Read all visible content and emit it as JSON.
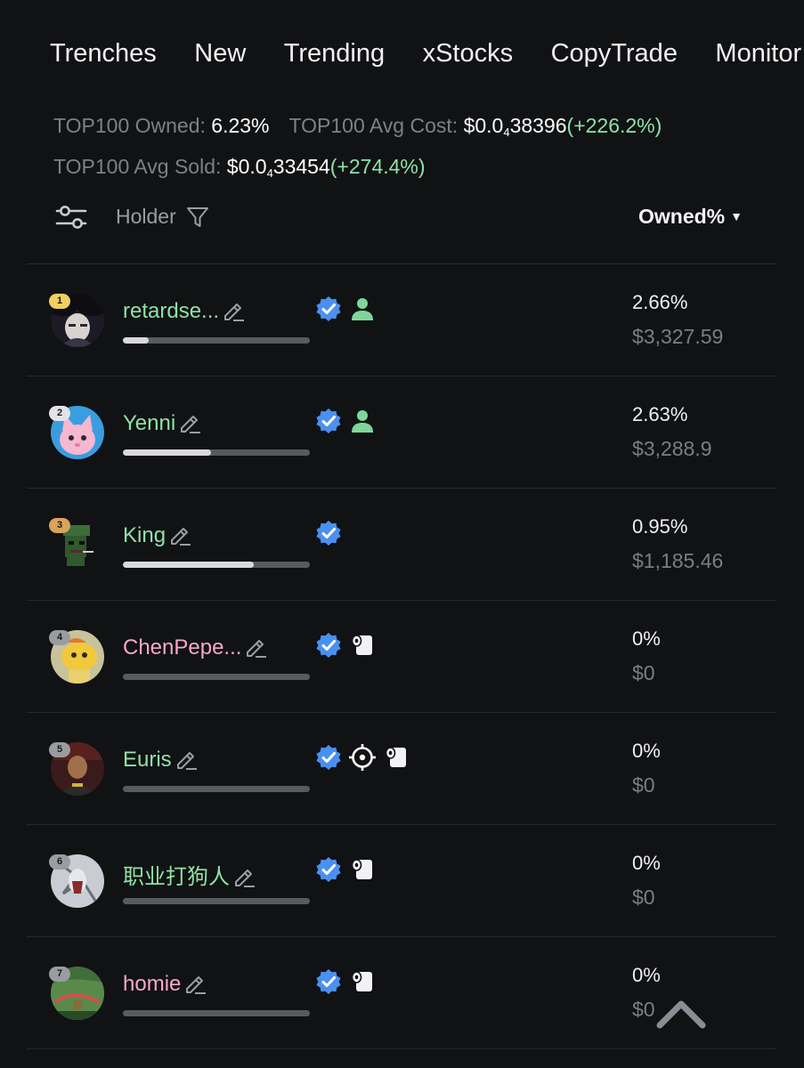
{
  "nav": {
    "tabs": [
      "Trenches",
      "New",
      "Trending",
      "xStocks",
      "CopyTrade",
      "Monitor"
    ]
  },
  "stats": {
    "owned_label": "TOP100 Owned:",
    "owned_value": "6.23%",
    "avg_cost_label": "TOP100 Avg Cost:",
    "avg_cost_prefix": "$0.0",
    "avg_cost_sub": "4",
    "avg_cost_digits": "38396",
    "avg_cost_change": "(+226.2%)",
    "avg_sold_label": "TOP100 Avg Sold:",
    "avg_sold_prefix": "$0.0",
    "avg_sold_sub": "4",
    "avg_sold_digits": "33454",
    "avg_sold_change": "(+274.4%)"
  },
  "table": {
    "holder_label": "Holder",
    "sort_label": "Owned%"
  },
  "colors": {
    "name_green": "#8fe2a6",
    "name_pink": "#f7a8c8",
    "verified_blue": "#4a90f0"
  },
  "holders": [
    {
      "rank": "1",
      "name": "retardse...",
      "name_color": "green",
      "bar": 0.14,
      "icons": [
        "verified-icon",
        "user-icon"
      ],
      "owned": "2.66%",
      "usd": "$3,327.59"
    },
    {
      "rank": "2",
      "name": "Yenni",
      "name_color": "green",
      "bar": 0.47,
      "icons": [
        "verified-icon",
        "user-icon"
      ],
      "owned": "2.63%",
      "usd": "$3,288.9"
    },
    {
      "rank": "3",
      "name": "King",
      "name_color": "green",
      "bar": 0.7,
      "icons": [
        "verified-icon"
      ],
      "owned": "0.95%",
      "usd": "$1,185.46"
    },
    {
      "rank": "4",
      "name": "ChenPepe...",
      "name_color": "pink",
      "bar": 0,
      "icons": [
        "verified-icon",
        "paper-roll-icon"
      ],
      "owned": "0%",
      "usd": "$0"
    },
    {
      "rank": "5",
      "name": "Euris",
      "name_color": "green",
      "bar": 0,
      "icons": [
        "verified-icon",
        "crosshair-icon",
        "paper-roll-icon"
      ],
      "owned": "0%",
      "usd": "$0"
    },
    {
      "rank": "6",
      "name": "职业打狗人",
      "name_color": "green",
      "bar": 0,
      "icons": [
        "verified-icon",
        "paper-roll-icon"
      ],
      "owned": "0%",
      "usd": "$0"
    },
    {
      "rank": "7",
      "name": "homie",
      "name_color": "pink",
      "bar": 0,
      "icons": [
        "verified-icon",
        "paper-roll-icon"
      ],
      "owned": "0%",
      "usd": "$0"
    }
  ]
}
